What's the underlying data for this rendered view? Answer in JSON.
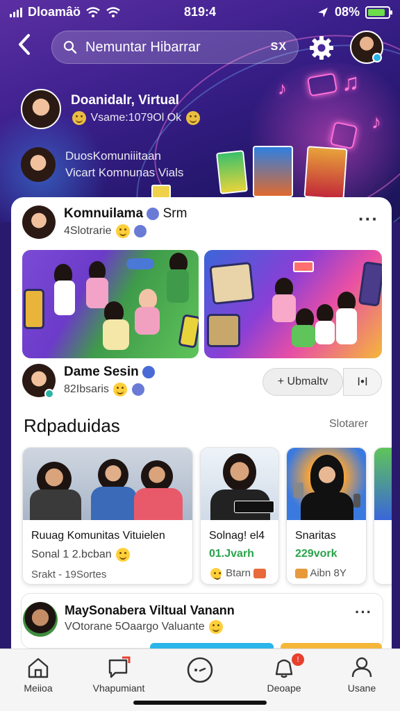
{
  "status_bar": {
    "carrier": "Dloamâö",
    "time": "819:4",
    "battery": "08%",
    "battery_level": 0.85
  },
  "nav": {
    "search_value": "Nemuntar Hibarrar",
    "clear_label": "SX"
  },
  "hero": {
    "row1": {
      "title": "Doanidalr, Virtual",
      "subtitle": "Vsame:1079Ol Ok"
    },
    "row2": {
      "title": "DuosKomuniiitaan",
      "subtitle": "Vicart Komnunas Vials"
    }
  },
  "post": {
    "author": "Komnuilama",
    "verified_suffix": "Srm",
    "meta": "4Slotrarie"
  },
  "session": {
    "name": "Dame Sesin",
    "meta": "82Ibsaris",
    "follow_label": "+ Ubmaltv",
    "more_label": "I•I"
  },
  "recommended": {
    "title": "Rdpaduidas",
    "link": "Slotarer",
    "cards": [
      {
        "title": "Ruuag Komunitas Vituielen",
        "line2": "Sonal 1 2.bcban",
        "line3": "Srakt - 19Sortes"
      },
      {
        "title": "Solnag! el4",
        "line2": "01.Jvarh",
        "line3": "Btarn"
      },
      {
        "title": "Snaritas",
        "line2": "229vork",
        "line3": "Aibn  8Y"
      }
    ]
  },
  "bottom_post": {
    "name": "MaySonabera Viltual Vanann",
    "meta": "VOtorane 5Oaargo Valuante"
  },
  "tabs": [
    {
      "label": "Meiioa",
      "icon": "home-icon"
    },
    {
      "label": "Vhapumiant",
      "icon": "message-icon"
    },
    {
      "label": "",
      "icon": "chat-bubble-icon"
    },
    {
      "label": "Deoape",
      "icon": "notification-icon"
    },
    {
      "label": "Usane",
      "icon": "user-icon"
    }
  ],
  "colors": {
    "hero_top": "#5b2fa3",
    "hero_bottom": "#1b1558",
    "accent_green": "#2aa24a",
    "badge_red": "#e8402f",
    "battery_green": "#6cdc4a"
  }
}
